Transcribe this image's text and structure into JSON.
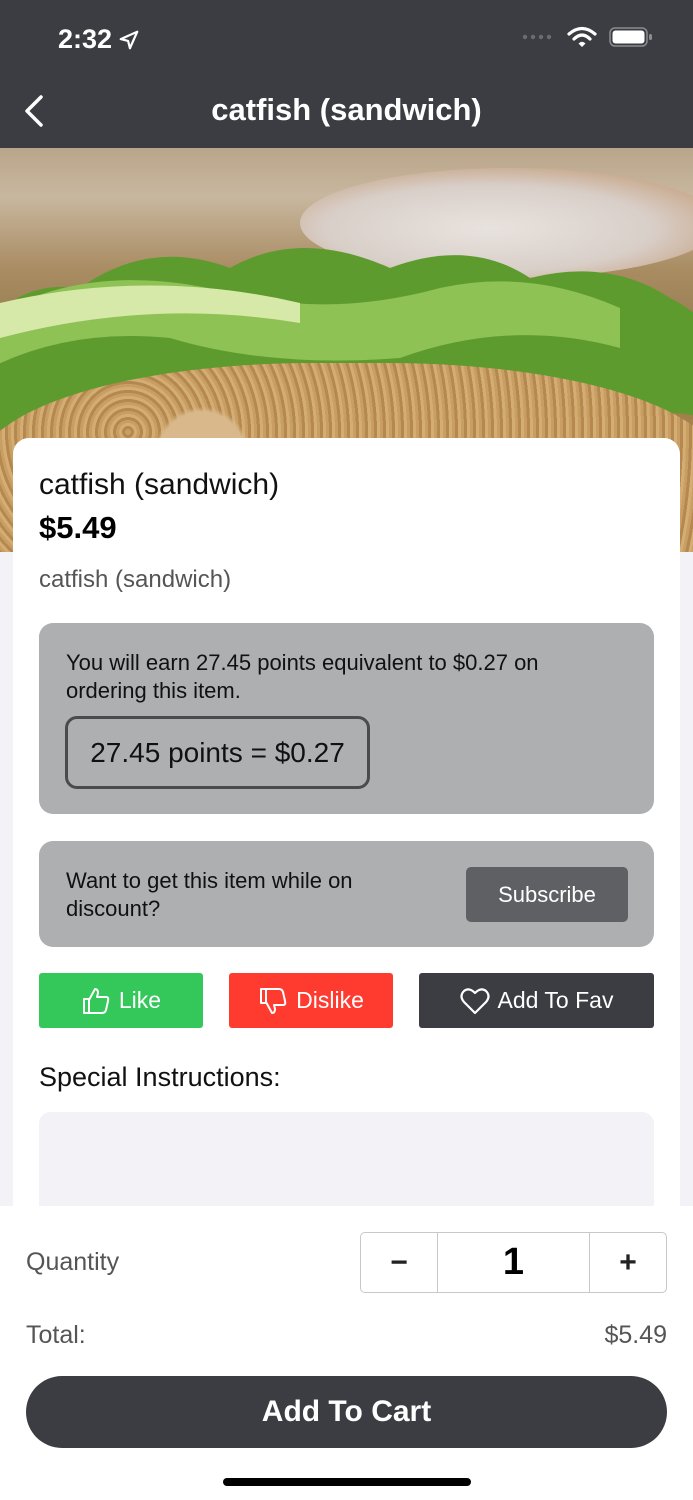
{
  "status_bar": {
    "time": "2:32"
  },
  "nav": {
    "title": "catfish (sandwich)"
  },
  "item": {
    "name": "catfish (sandwich)",
    "price": "$5.49",
    "description": "catfish (sandwich)"
  },
  "points": {
    "message": "You will earn 27.45 points equivalent to $0.27 on ordering this item.",
    "pill": "27.45 points = $0.27"
  },
  "subscribe": {
    "message": "Want to get this item while on discount?",
    "button": "Subscribe"
  },
  "actions": {
    "like": "Like",
    "dislike": "Dislike",
    "fav": "Add To Fav"
  },
  "special": {
    "label": "Special Instructions:",
    "value": ""
  },
  "quantity": {
    "label": "Quantity",
    "minus": "−",
    "value": "1",
    "plus": "+"
  },
  "total": {
    "label": "Total:",
    "value": "$5.49"
  },
  "cart": {
    "button": "Add To Cart"
  },
  "colors": {
    "header": "#3b3d42",
    "like": "#34c759",
    "dislike": "#ff3b30",
    "panel": "#aeafb1"
  }
}
